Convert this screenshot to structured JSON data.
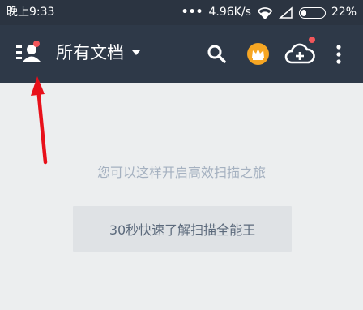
{
  "status_bar": {
    "time": "晚上9:33",
    "network_speed": "4.96K/s",
    "battery_percent": "22%",
    "icons": [
      "signal-dots-icon",
      "wifi-icon",
      "signal-bars-icon",
      "battery-icon"
    ]
  },
  "app_bar": {
    "title": "所有文档",
    "icons": [
      "user-menu-icon",
      "dropdown-caret-icon",
      "search-icon",
      "vip-crown-icon",
      "cloud-upload-icon",
      "more-vert-icon"
    ],
    "notification_color": "#f2565a",
    "accent_vip": "#f6a623"
  },
  "main": {
    "empty_hint": "您可以这样开启高效扫描之旅",
    "tour_button_label": "30秒快速了解扫描全能王"
  },
  "annotation": {
    "arrow_color": "#e8101a"
  }
}
